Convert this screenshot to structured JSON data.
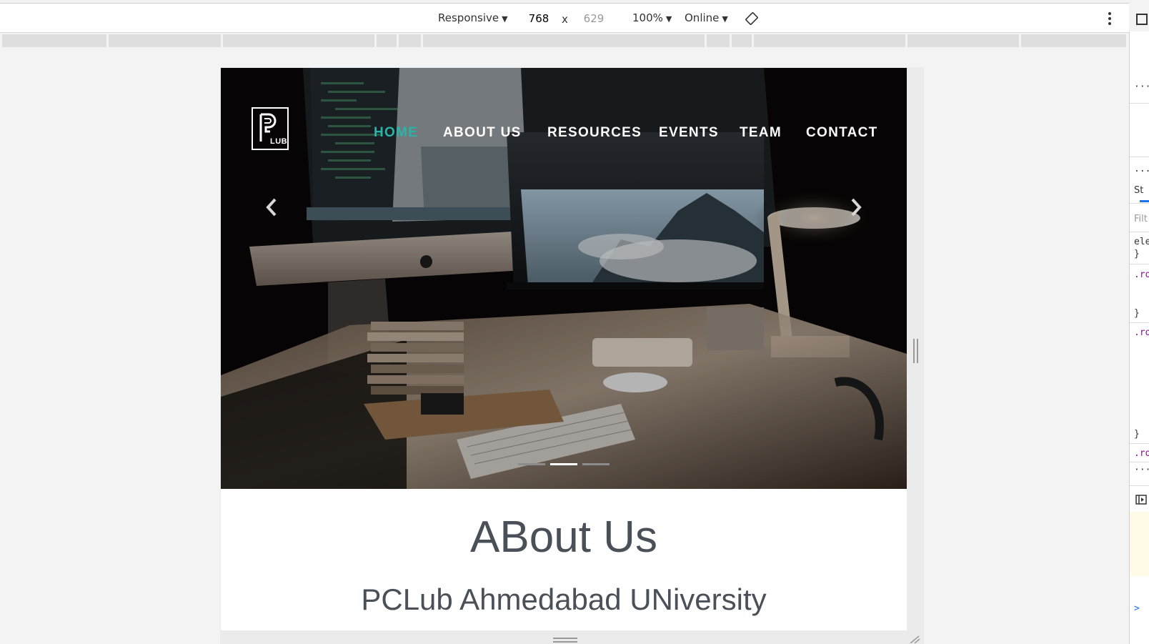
{
  "devtools": {
    "device_mode": "Responsive",
    "width": "768",
    "times": "x",
    "height": "629",
    "zoom": "100%",
    "throttle": "Online",
    "side_panel": {
      "more_top": "···",
      "more_mid": "...",
      "styles_tab": "St",
      "filter_placeholder": "Filt",
      "element_line": "ele",
      "brace": "}",
      "rule1": ".ro",
      "rule2": ".ro",
      "rule3": ".ro",
      "more_bottom": "···",
      "console_prompt": ">"
    }
  },
  "site": {
    "logo_text": "LUB",
    "nav": [
      {
        "label": "HOME",
        "active": true
      },
      {
        "label": "ABOUT US",
        "active": false
      },
      {
        "label": "RESOURCES",
        "active": false
      },
      {
        "label": "EVENTS",
        "active": false
      },
      {
        "label": "TEAM",
        "active": false
      },
      {
        "label": "CONTACT",
        "active": false
      }
    ],
    "carousel": {
      "slides": 3,
      "active_index": 1
    },
    "about_title": "ABout Us",
    "about_subtitle": "PCLub Ahmedabad UNiversity",
    "accent_color": "#2ab3a6"
  }
}
